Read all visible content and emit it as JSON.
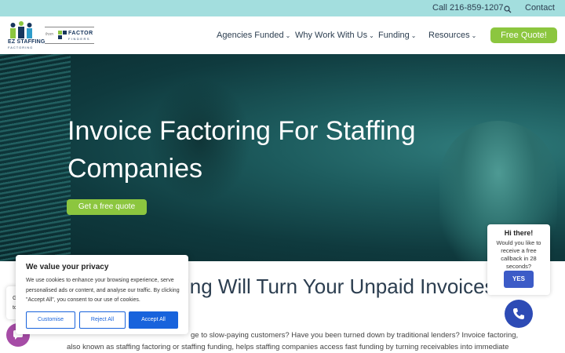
{
  "topbar": {
    "phone": "Call 216-859-1207",
    "search_icon": "search-icon",
    "contact": "Contact"
  },
  "logo": {
    "brand": "EZ STAFFING",
    "brand_sub": "FACTORING",
    "from": "from",
    "partner": "FACTOR",
    "partner_sub": "FINDERS"
  },
  "nav": {
    "items": [
      {
        "label": "Agencies Funded"
      },
      {
        "label": "Why Work With Us"
      },
      {
        "label": "Funding"
      },
      {
        "label": "Resources"
      }
    ],
    "cta": "Free Quote!"
  },
  "hero": {
    "title_line1": "Invoice Factoring For Staffing",
    "title_line2": "Companies",
    "button": "Get a free quote"
  },
  "section": {
    "heading_visible": "ing Will Turn Your Unpaid Invoices",
    "para_line1": "ge to slow-paying customers? Have you been turned down by traditional lenders? Invoice factoring,",
    "para_line2": "also known as staffing factoring or staffing funding, helps staffing companies access fast funding by turning receivables into immediate"
  },
  "cookie": {
    "title": "We value your privacy",
    "text": "We use cookies to enhance your browsing experience, serve personalised ads or content, and analyse our traffic. By clicking \"Accept All\", you consent to our use of cookies.",
    "customise": "Customise",
    "reject": "Reject All",
    "accept": "Accept All"
  },
  "side_fragment": {
    "line1": "G",
    "line2": "tc"
  },
  "chat": {
    "greeting": "Hi there!",
    "message": "Would you like to receive a free callback in 28 seconds?",
    "yes": "YES"
  },
  "colors": {
    "topbar": "#a3dede",
    "accent_green": "#8cc63f",
    "hero_dark": "#0f3a3e",
    "cookie_blue": "#1863dc",
    "chat_blue": "#3c5bc7"
  }
}
